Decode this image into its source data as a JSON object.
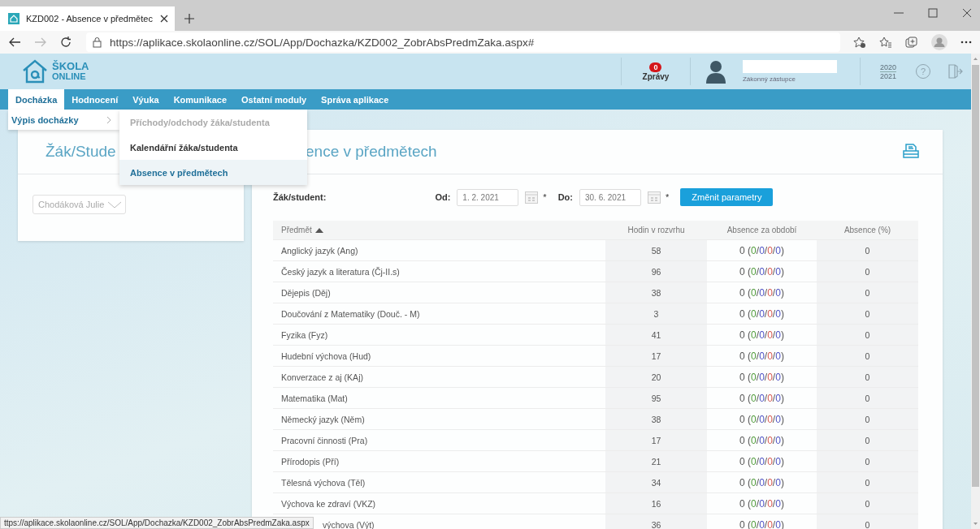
{
  "browser": {
    "tab_title": "KZD002 - Absence v předmětec",
    "url": "https://aplikace.skolaonline.cz/SOL/App/Dochazka/KZD002_ZobrAbsPredmZaka.aspx#"
  },
  "header": {
    "logo_top": "ŠKOLA",
    "logo_bottom": "ONLINE",
    "messages_count": "0",
    "messages_label": "Zprávy",
    "user_role": "Zákonný zástupce",
    "year_from": "2020",
    "year_to": "2021",
    "help": "?"
  },
  "nav": [
    {
      "label": "Docházka",
      "selected": true
    },
    {
      "label": "Hodnocení",
      "selected": false
    },
    {
      "label": "Výuka",
      "selected": false
    },
    {
      "label": "Komunikace",
      "selected": false
    },
    {
      "label": "Ostatní moduly",
      "selected": false
    },
    {
      "label": "Správa aplikace",
      "selected": false
    }
  ],
  "menu": {
    "section": "Výpis docházky",
    "items": [
      {
        "label": "Příchody/odchody žáka/studenta",
        "disabled": true,
        "selected": false
      },
      {
        "label": "Kalendářní žáka/studenta",
        "disabled": false,
        "selected": false
      },
      {
        "label": "Absence v předmětech",
        "disabled": false,
        "selected": true
      }
    ]
  },
  "student_panel": {
    "title": "Žák/Stude",
    "student": "Chodáková Julie"
  },
  "main": {
    "title": "ence v předmětech",
    "filters": {
      "student_label": "Žák/student:",
      "from_label": "Od:",
      "from": "1. 2. 2021",
      "from_required": "*",
      "to_label": "Do:",
      "to": "30. 6. 2021",
      "to_required": "*",
      "button": "Změnit parametry"
    },
    "table": {
      "columns": [
        "Předmět",
        "Hodin v rozvrhu",
        "Absence za období",
        "Absence (%)"
      ],
      "absence_parts": [
        {
          "color": "#4f9a3a"
        },
        {
          "color": "#4e52c4"
        },
        {
          "color": "#d65a52"
        },
        {
          "color": "#4e52c4"
        }
      ],
      "rows": [
        {
          "subject": "Anglický jazyk (Ang)",
          "hours": "58",
          "absence": "0 (0/0/0/0)",
          "percent": "0",
          "covered": false
        },
        {
          "subject": "Český jazyk a literatura (Čj-II.s)",
          "hours": "96",
          "absence": "0 (0/0/0/0)",
          "percent": "0",
          "covered": false
        },
        {
          "subject": "Dějepis (Děj)",
          "hours": "38",
          "absence": "0 (0/0/0/0)",
          "percent": "0",
          "covered": false
        },
        {
          "subject": "Doučování z Matematiky (Douč. - M)",
          "hours": "3",
          "absence": "0 (0/0/0/0)",
          "percent": "0",
          "covered": false
        },
        {
          "subject": "Fyzika (Fyz)",
          "hours": "41",
          "absence": "0 (0/0/0/0)",
          "percent": "0",
          "covered": false
        },
        {
          "subject": "Hudební výchova (Hud)",
          "hours": "17",
          "absence": "0 (0/0/0/0)",
          "percent": "0",
          "covered": false
        },
        {
          "subject": "Konverzace z aj (KAj)",
          "hours": "20",
          "absence": "0 (0/0/0/0)",
          "percent": "0",
          "covered": false
        },
        {
          "subject": "Matematika (Mat)",
          "hours": "95",
          "absence": "0 (0/0/0/0)",
          "percent": "0",
          "covered": false
        },
        {
          "subject": "Německý jazyk (Něm)",
          "hours": "38",
          "absence": "0 (0/0/0/0)",
          "percent": "0",
          "covered": false
        },
        {
          "subject": "Pracovní činnosti (Pra)",
          "hours": "17",
          "absence": "0 (0/0/0/0)",
          "percent": "0",
          "covered": false
        },
        {
          "subject": "Přírodopis (Pří)",
          "hours": "21",
          "absence": "0 (0/0/0/0)",
          "percent": "0",
          "covered": false
        },
        {
          "subject": "Tělesná výchova (Těl)",
          "hours": "34",
          "absence": "0 (0/0/0/0)",
          "percent": "0",
          "covered": false
        },
        {
          "subject": "Výchova ke zdraví (VKZ)",
          "hours": "16",
          "absence": "0 (0/0/0/0)",
          "percent": "0",
          "covered": false
        },
        {
          "subject": "výchova (Výt)",
          "hours": "36",
          "absence": "0 (0/0/0/0)",
          "percent": "0",
          "covered": true
        }
      ]
    }
  },
  "status_url": "ttps://aplikace.skolaonline.cz/SOL/App/Dochazka/KZD002_ZobrAbsPredmZaka.aspx"
}
